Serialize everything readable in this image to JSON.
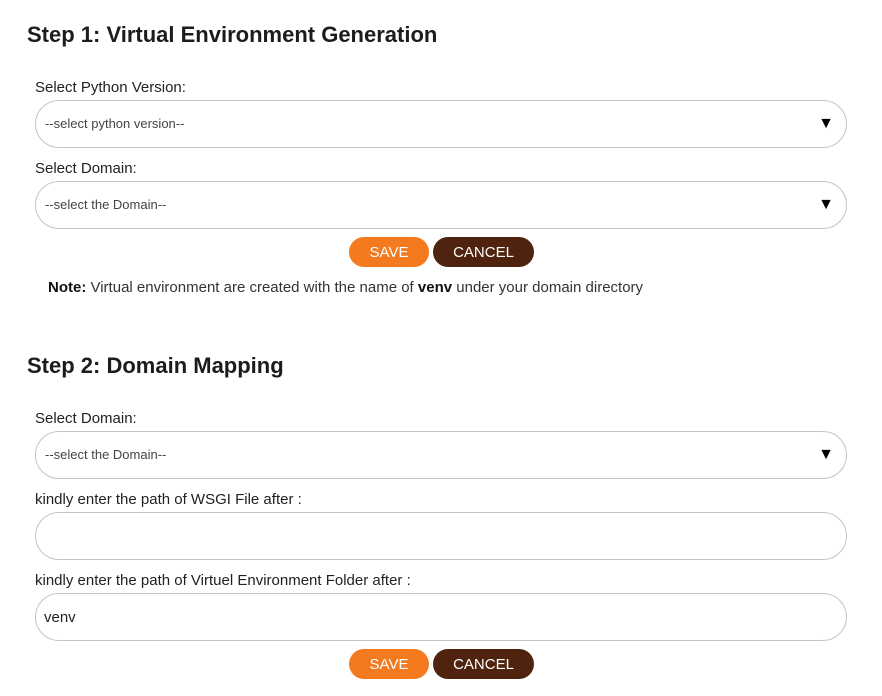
{
  "step1": {
    "heading": "Step 1: Virtual Environment Generation",
    "python_label": "Select Python Version:",
    "python_value": "--select python version--",
    "domain_label": "Select Domain:",
    "domain_value": "--select the Domain--",
    "save_label": "SAVE",
    "cancel_label": "CANCEL",
    "note": {
      "prefix": "Note:",
      "text_before": " Virtual environment are created with the name of ",
      "bold_word": "venv",
      "text_after": " under your domain directory"
    }
  },
  "step2": {
    "heading": "Step 2: Domain Mapping",
    "domain_label": "Select Domain:",
    "domain_value": "--select the Domain--",
    "wsgi_label": "kindly enter the path of WSGI File after  :",
    "wsgi_value": "",
    "venv_label": "kindly enter the path of Virtuel Environment Folder after  :",
    "venv_value": "venv",
    "save_label": "SAVE",
    "cancel_label": "CANCEL"
  },
  "icons": {
    "dropdown": "▼"
  },
  "colors": {
    "save": "#f47a1f",
    "cancel": "#4f230d"
  }
}
